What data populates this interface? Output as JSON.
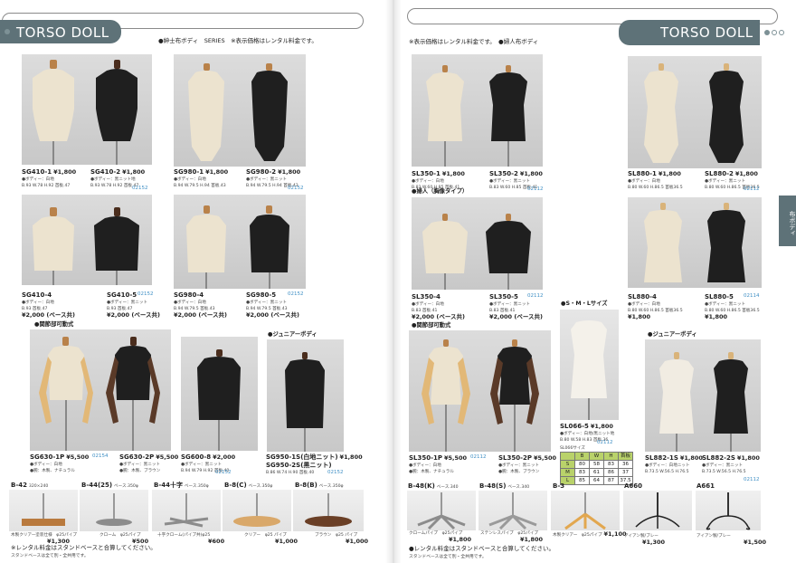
{
  "left_title": "TORSO DOLL",
  "right_title": "TORSO DOLL",
  "left_header_note": "●紳士布ボディ　SERIES　※表示価格はレンタル料金です。",
  "right_header_note": "※表示価格はレンタル料金です。　●婦人布ボディ",
  "side_tab": "布ボディ",
  "colors": {
    "tab": "#5e7278",
    "dot": "#7d9196",
    "catalog_no": "#3f8fc5",
    "size_table": "#b9d26a"
  },
  "products": [
    {
      "code": "SG410-1",
      "price": "¥1,800",
      "spec1": "●ボディー：白地",
      "spec2": "B.93 W.78 H.92 首板.47"
    },
    {
      "code": "SG410-2",
      "price": "¥1,800",
      "spec1": "●ボディー：黒ニット地",
      "spec2": "B.93 W.78 H.92 首板.47"
    },
    {
      "code": "SG980-1",
      "price": "¥1,800",
      "spec1": "●ボディー：白地",
      "spec2": "B.94 W.79.5 H.94 首板.43"
    },
    {
      "code": "SG980-2",
      "price": "¥1,800",
      "spec1": "●ボディー：黒ニット",
      "spec2": "B.94 W.79.5 H.94 首板.43"
    },
    {
      "code": "SG410-4",
      "price": "¥2,000 (ベース共)",
      "spec1": "●ボディー：白地",
      "spec2": "B.93 首板.47"
    },
    {
      "code": "SG410-5",
      "price": "¥2,000 (ベース共)",
      "spec1": "●ボディー：黒ニット",
      "spec2": "B.93 首板.47"
    },
    {
      "code": "SG980-4",
      "price": "¥2,000 (ベース共)",
      "spec1": "●ボディー：白地",
      "spec2": "B.94 W.79.5 首板.43"
    },
    {
      "code": "SG980-5",
      "price": "¥2,000 (ベース共)",
      "spec1": "●ボディー：黒ニット",
      "spec2": "B.94 W.79.5 首板.43"
    },
    {
      "code": "SG630-1P",
      "price": "¥5,500",
      "spec1": "●ボディー：白地",
      "spec2": "●腕：木製、ナチュラル"
    },
    {
      "code": "SG630-2P",
      "price": "¥5,500",
      "spec1": "●ボディー：黒ニット",
      "spec2": "●腕：木製、ブラウン"
    },
    {
      "code": "SG600-8",
      "price": "¥2,000",
      "spec1": "●ボディー：黒ニット",
      "spec2": "B.94 W.79 H.92 首板.40"
    },
    {
      "code": "SG950-1S(白地ニット)",
      "price": "¥1,800",
      "spec1": "SG950-2S(黒ニット)",
      "spec2": "B.86 W.74 H.90 首板.40"
    },
    {
      "code": "SL350-1",
      "price": "¥1,800",
      "spec1": "●ボディー：白地",
      "spec2": "B.83 W.60 H.85 首板.41"
    },
    {
      "code": "SL350-2",
      "price": "¥1,800",
      "spec1": "●ボディー：黒ニット",
      "spec2": "B.83 W.60 H.85 首板.41"
    },
    {
      "code": "SL880-1",
      "price": "¥1,800",
      "spec1": "●ボディー：白地",
      "spec2": "B.80 W.60 H.86.5 首板36.5"
    },
    {
      "code": "SL880-2",
      "price": "¥1,800",
      "spec1": "●ボディー：黒ニット",
      "spec2": "B.80 W.60 H.86.5 首板36.5"
    },
    {
      "code": "SL350-4",
      "price": "¥2,000 (ベース共)",
      "spec1": "●ボディー：白地",
      "spec2": "B.83 首板.41"
    },
    {
      "code": "SL350-5",
      "price": "¥2,000 (ベース共)",
      "spec1": "●ボディー：黒ニット",
      "spec2": "B.83 首板.41"
    },
    {
      "code": "SL880-4",
      "price": "¥1,800",
      "spec1": "●ボディー：白地",
      "spec2": "B.80 W.60 H.86.5 首板36.5"
    },
    {
      "code": "SL880-5",
      "price": "¥1,800",
      "spec1": "●ボディー：黒ニット",
      "spec2": "B.80 W.60 H.86.5 首板36.5"
    },
    {
      "code": "SL350-1P",
      "price": "¥5,500",
      "spec1": "●ボディー：白地",
      "spec2": "●腕：木製、ナチュラル"
    },
    {
      "code": "SL350-2P",
      "price": "¥5,500",
      "spec1": "●ボディー：黒ニット",
      "spec2": "●腕：木製、ブラウン"
    },
    {
      "code": "SL066-5",
      "price": "¥1,800",
      "spec1": "●ボディー：白地/黒ニット地",
      "spec2": "B.80 W.58 H.83 首板.36"
    },
    {
      "code": "SL882-1S",
      "price": "¥1,800",
      "spec1": "●ボディー：白地ニット",
      "spec2": "B.73.5 W.56.5 H.76.5"
    },
    {
      "code": "SL882-2S",
      "price": "¥1,800",
      "spec1": "●ボディー：黒ニット",
      "spec2": "B.73.5 W.56.5 H.76.5"
    }
  ],
  "catalog_numbers": [
    "02152",
    "02152",
    "02152",
    "02152",
    "02154",
    "02152",
    "02152",
    "02112",
    "02112",
    "02112",
    "02112",
    "02114",
    "02112",
    "02112",
    "02112"
  ],
  "sections": {
    "arm_left": "●関節部可動式",
    "junior_left": "●ジュニアーボディ",
    "lady_bust": "●婦人（胸像タイプ）",
    "arm_right": "●関節部可動式",
    "sml": "●S・M・Lサイズ",
    "junior_right": "●ジュニアーボディ"
  },
  "size_table": {
    "title": "SL066サイズ",
    "headers": [
      "",
      "B",
      "W",
      "H",
      "首板"
    ],
    "rows": [
      [
        "S",
        "80",
        "58",
        "83",
        "36"
      ],
      [
        "M",
        "83",
        "61",
        "86",
        "37"
      ],
      [
        "L",
        "85",
        "64",
        "87",
        "37.5"
      ]
    ]
  },
  "bases_left": [
    {
      "code": "B-42",
      "size": "320×240",
      "desc": "木製クリアー塗装仕様　φ25パイプ",
      "price": "¥1,300"
    },
    {
      "code": "B-44(25)",
      "size": "ベース.350φ",
      "desc": "クローム　φ25パイプ",
      "price": "¥500"
    },
    {
      "code": "B-44十字",
      "size": "ベース.350φ",
      "desc": "十字クローム(パイプ共)φ25",
      "price": "¥600"
    },
    {
      "code": "B-8(C)",
      "size": "ベース.350φ",
      "desc": "クリアー　φ25 パイプ",
      "price": "¥1,000"
    },
    {
      "code": "B-8(B)",
      "size": "ベース.350φ",
      "desc": "ブラウン　φ25 パイプ",
      "price": "¥1,000"
    }
  ],
  "bases_right": [
    {
      "code": "B-48(K)",
      "size": "ベース.340",
      "desc": "クロームパイプ　φ25パイプ",
      "price": "¥1,800"
    },
    {
      "code": "B-48(S)",
      "size": "ベース.340",
      "desc": "ステンレスパイプ　φ25パイプ",
      "price": "¥1,800"
    },
    {
      "code": "B-3",
      "size": "",
      "desc": "木製クリアー　φ25パイプ",
      "price": "¥1,100"
    },
    {
      "code": "A660",
      "size": "",
      "desc": "アイアン製/ブレー",
      "price": "¥1,300"
    },
    {
      "code": "A661",
      "size": "",
      "desc": "アイアン製/ブレー",
      "price": "¥1,500"
    }
  ],
  "footnote_left": "※レンタル料金はスタンドベースと合算してください。",
  "footnote_left_sub": "スタンドベースは全て別・全共用です。",
  "footnote_right": "●レンタル料金はスタンドベースと合算してください。",
  "footnote_right_sub": "スタンドベースは全て別・全共用です。"
}
